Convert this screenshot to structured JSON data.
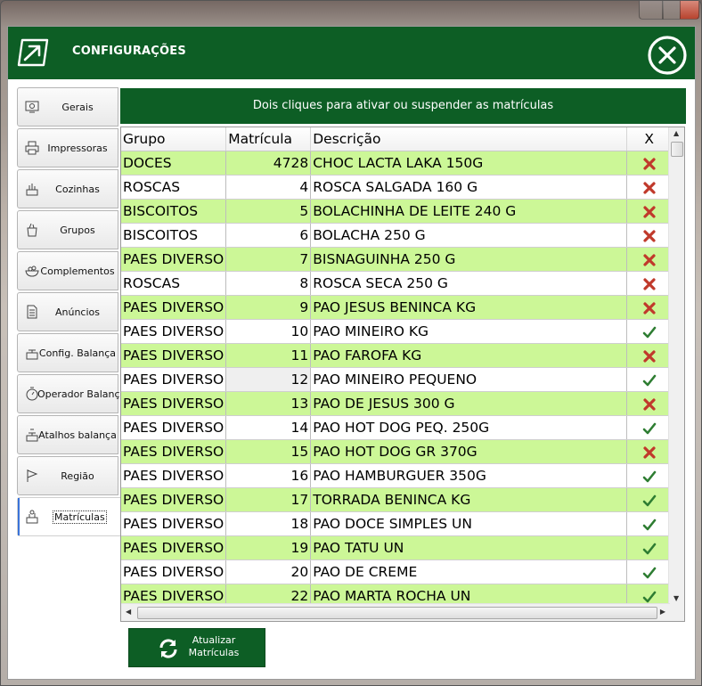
{
  "window": {
    "title": "CONFIGURAÇÕES"
  },
  "tabs": [
    {
      "label": "Gerais",
      "icon": "monitor-gear-icon"
    },
    {
      "label": "Impressoras",
      "icon": "printer-icon"
    },
    {
      "label": "Cozinhas",
      "icon": "kitchen-icon"
    },
    {
      "label": "Grupos",
      "icon": "groups-icon"
    },
    {
      "label": "Complementos",
      "icon": "bowl-icon"
    },
    {
      "label": "Anúncios",
      "icon": "document-icon"
    },
    {
      "label": "Config. Balança",
      "icon": "scale-icon"
    },
    {
      "label": "Operador  Balança",
      "icon": "timer-icon"
    },
    {
      "label": "Atalhos balança",
      "icon": "scale-shortcut-icon"
    },
    {
      "label": "Região",
      "icon": "flag-icon"
    },
    {
      "label": "Matrículas",
      "icon": "matriculas-icon"
    }
  ],
  "active_tab": "Matrículas",
  "banner": "Dois cliques para ativar ou suspender as matrículas",
  "table": {
    "columns": [
      "Grupo",
      "Matrícula",
      "Descrição",
      "X"
    ],
    "rows": [
      {
        "grupo": "DOCES",
        "matricula": "4728",
        "descricao": "CHOC LACTA LAKA 150G",
        "status": "suspended"
      },
      {
        "grupo": "ROSCAS",
        "matricula": "4",
        "descricao": "ROSCA SALGADA 160 G",
        "status": "suspended"
      },
      {
        "grupo": "BISCOITOS",
        "matricula": "5",
        "descricao": "BOLACHINHA DE LEITE 240 G",
        "status": "suspended"
      },
      {
        "grupo": "BISCOITOS",
        "matricula": "6",
        "descricao": "BOLACHA 250 G",
        "status": "suspended"
      },
      {
        "grupo": "PAES DIVERSO",
        "matricula": "7",
        "descricao": "BISNAGUINHA 250 G",
        "status": "suspended"
      },
      {
        "grupo": "ROSCAS",
        "matricula": "8",
        "descricao": "ROSCA SECA 250 G",
        "status": "suspended"
      },
      {
        "grupo": "PAES DIVERSO",
        "matricula": "9",
        "descricao": "PAO JESUS BENINCA KG",
        "status": "suspended"
      },
      {
        "grupo": "PAES DIVERSO",
        "matricula": "10",
        "descricao": "PAO MINEIRO KG",
        "status": "active"
      },
      {
        "grupo": "PAES DIVERSO",
        "matricula": "11",
        "descricao": "PAO FAROFA KG",
        "status": "suspended"
      },
      {
        "grupo": "PAES DIVERSO",
        "matricula": "12",
        "descricao": "PAO MINEIRO PEQUENO",
        "status": "active"
      },
      {
        "grupo": "PAES DIVERSO",
        "matricula": "13",
        "descricao": "PAO DE JESUS 300 G",
        "status": "suspended"
      },
      {
        "grupo": "PAES DIVERSO",
        "matricula": "14",
        "descricao": "PAO HOT DOG PEQ. 250G",
        "status": "active"
      },
      {
        "grupo": "PAES DIVERSO",
        "matricula": "15",
        "descricao": "PAO HOT DOG GR 370G",
        "status": "suspended"
      },
      {
        "grupo": "PAES DIVERSO",
        "matricula": "16",
        "descricao": "PAO HAMBURGUER 350G",
        "status": "active"
      },
      {
        "grupo": "PAES DIVERSO",
        "matricula": "17",
        "descricao": "TORRADA BENINCA KG",
        "status": "active"
      },
      {
        "grupo": "PAES DIVERSO",
        "matricula": "18",
        "descricao": "PAO DOCE SIMPLES UN",
        "status": "active"
      },
      {
        "grupo": "PAES DIVERSO",
        "matricula": "19",
        "descricao": "PAO TATU UN",
        "status": "active"
      },
      {
        "grupo": "PAES DIVERSO",
        "matricula": "20",
        "descricao": "PAO DE CREME",
        "status": "active"
      },
      {
        "grupo": "PAES DIVERSO",
        "matricula": "22",
        "descricao": "PAO MARTA ROCHA UN",
        "status": "active"
      }
    ]
  },
  "update_button": {
    "line1": "Atualizar",
    "line2": "Matrículas",
    "icon": "refresh-icon"
  },
  "colors": {
    "header_green": "#0d5e25",
    "row_green": "#ccf797",
    "status_red": "#c0392b",
    "status_green": "#2e7d32"
  }
}
